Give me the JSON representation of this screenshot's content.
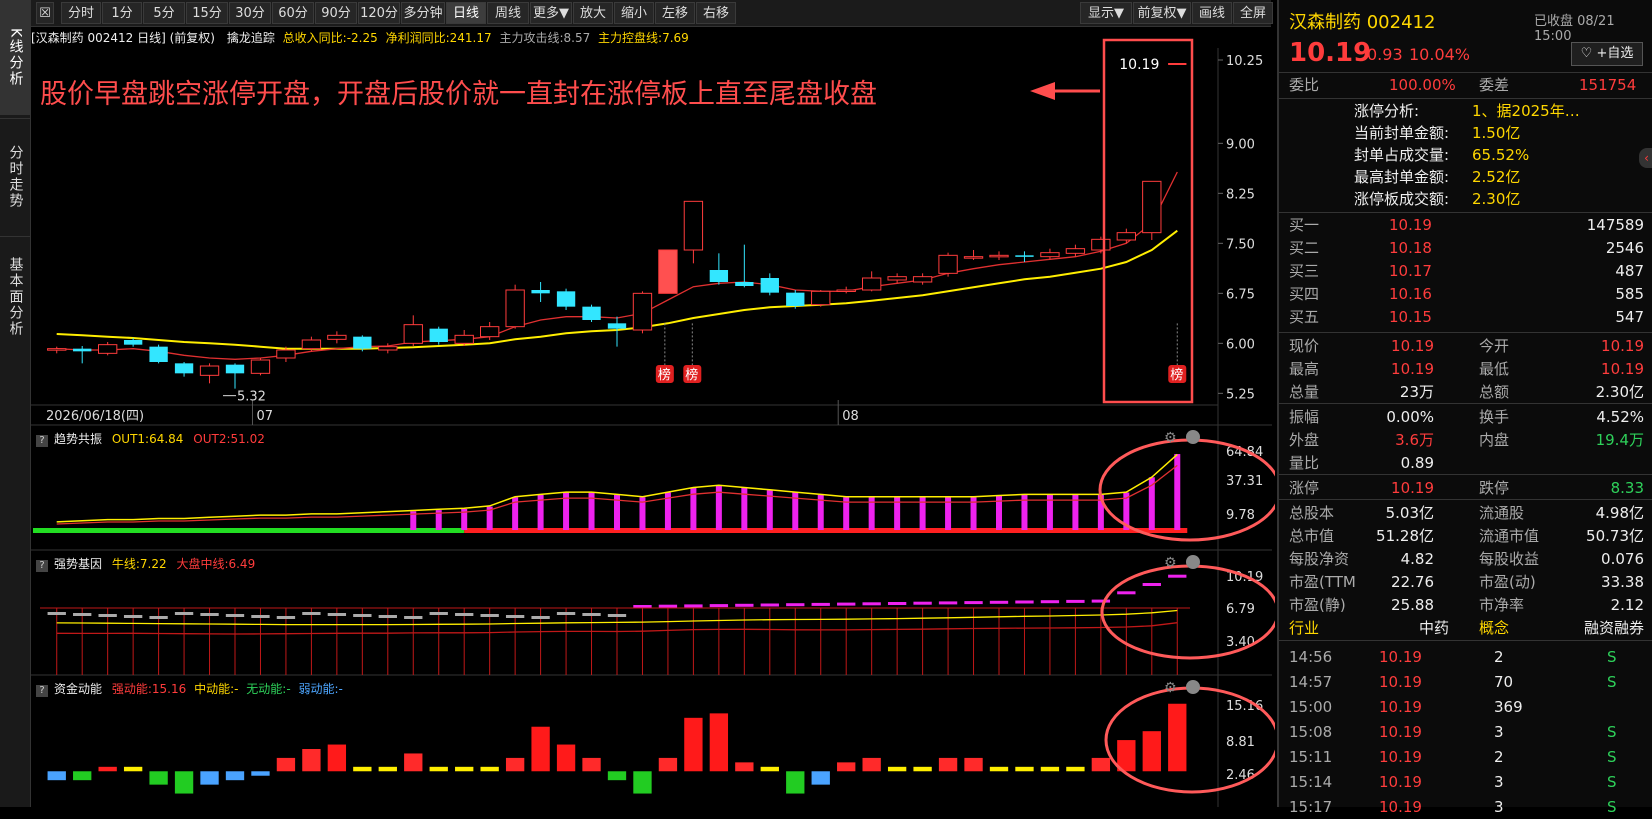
{
  "toolbar": {
    "buttons": [
      "分时",
      "1分",
      "5分",
      "15分",
      "30分",
      "60分",
      "90分",
      "120分",
      "多分钟",
      "日线",
      "周线",
      "更多▼",
      "放大",
      "缩小",
      "左移",
      "右移"
    ],
    "right_buttons": [
      "显示▼",
      "前复权▼",
      "画线",
      "全屏"
    ],
    "active": "日线"
  },
  "left_nav": [
    "K线分析",
    "分时走势",
    "基本面分析"
  ],
  "info_bar": {
    "title": "[汉森制药 002412 日线] (前复权)",
    "indicator": "擒龙追踪",
    "revenue_yoy": "总收入同比:-2.25",
    "profit_yoy": "净利润同比:241.17",
    "attack_line": "主力攻击线:8.57",
    "control_line": "主力控盘线:7.69"
  },
  "annotation": "股价早盘跳空涨停开盘，开盘后股价就一直封在涨停板上直至尾盘收盘",
  "main_chart": {
    "y_ticks": [
      "10.25",
      "9.00",
      "8.25",
      "7.50",
      "6.75",
      "6.00",
      "5.25"
    ],
    "date_label": "2026/06/18(四)",
    "month_labels": [
      "07",
      "08"
    ],
    "low_label": "5.32",
    "last_price_label": "10.19",
    "bang": "榜"
  },
  "indicator1": {
    "name": "趋势共振",
    "out1": "OUT1:64.84",
    "out2": "OUT2:51.02",
    "y_ticks": [
      "64.84",
      "37.31",
      "9.78"
    ]
  },
  "indicator2": {
    "name": "强势基因",
    "bull": "牛线:7.22",
    "market": "大盘中线:6.49",
    "y_ticks": [
      "10.19",
      "6.79",
      "3.40"
    ]
  },
  "indicator3": {
    "name": "资金动能",
    "strong": "强动能:15.16",
    "mid": "中动能:-",
    "none": "无动能:-",
    "weak": "弱动能:-",
    "y_ticks": [
      "15.16",
      "8.81",
      "2.46"
    ]
  },
  "chart_data": {
    "type": "candlestick",
    "dates": [
      "06/18"
    ],
    "candles": [
      [
        5.9,
        5.92,
        5.95,
        5.85
      ],
      [
        5.92,
        5.88,
        5.96,
        5.7
      ],
      [
        5.85,
        5.98,
        6.02,
        5.82
      ],
      [
        6.05,
        5.98,
        6.08,
        5.95
      ],
      [
        5.95,
        5.72,
        5.98,
        5.7
      ],
      [
        5.7,
        5.55,
        5.72,
        5.5
      ],
      [
        5.52,
        5.66,
        5.7,
        5.4
      ],
      [
        5.68,
        5.55,
        5.7,
        5.32
      ],
      [
        5.55,
        5.75,
        5.78,
        5.52
      ],
      [
        5.78,
        5.9,
        5.95,
        5.72
      ],
      [
        5.92,
        6.05,
        6.1,
        5.88
      ],
      [
        6.06,
        6.12,
        6.18,
        6.0
      ],
      [
        6.1,
        5.92,
        6.12,
        5.88
      ],
      [
        5.9,
        5.95,
        6.0,
        5.85
      ],
      [
        6.0,
        6.28,
        6.42,
        5.96
      ],
      [
        6.22,
        6.02,
        6.25,
        5.98
      ],
      [
        6.0,
        6.12,
        6.2,
        5.96
      ],
      [
        6.1,
        6.25,
        6.32,
        6.05
      ],
      [
        6.25,
        6.8,
        6.88,
        6.22
      ],
      [
        6.8,
        6.75,
        6.92,
        6.62
      ],
      [
        6.78,
        6.55,
        6.82,
        6.5
      ],
      [
        6.55,
        6.35,
        6.58,
        6.32
      ],
      [
        6.3,
        6.22,
        6.4,
        5.95
      ],
      [
        6.2,
        6.75,
        6.78,
        6.15
      ],
      [
        6.75,
        7.4,
        7.4,
        6.75
      ],
      [
        7.4,
        8.13,
        8.13,
        7.2
      ],
      [
        7.1,
        6.92,
        7.35,
        6.88
      ],
      [
        6.92,
        6.86,
        7.48,
        6.84
      ],
      [
        6.98,
        6.76,
        7.05,
        6.72
      ],
      [
        6.76,
        6.56,
        6.8,
        6.52
      ],
      [
        6.58,
        6.78,
        6.8,
        6.55
      ],
      [
        6.78,
        6.8,
        6.85,
        6.75
      ],
      [
        6.8,
        6.98,
        7.08,
        6.78
      ],
      [
        6.95,
        7.0,
        7.05,
        6.9
      ],
      [
        6.92,
        7.0,
        7.05,
        6.88
      ],
      [
        7.05,
        7.32,
        7.36,
        7.0
      ],
      [
        7.28,
        7.3,
        7.4,
        7.25
      ],
      [
        7.3,
        7.32,
        7.38,
        7.25
      ],
      [
        7.32,
        7.3,
        7.38,
        7.22
      ],
      [
        7.3,
        7.36,
        7.42,
        7.26
      ],
      [
        7.35,
        7.42,
        7.48,
        7.3
      ],
      [
        7.4,
        7.56,
        7.6,
        7.35
      ],
      [
        7.55,
        7.66,
        7.72,
        7.5
      ],
      [
        7.66,
        8.43,
        8.43,
        7.55
      ],
      [
        10.19,
        10.19,
        10.19,
        10.19
      ]
    ],
    "ma_red": [
      5.92,
      5.9,
      5.9,
      5.92,
      5.88,
      5.82,
      5.78,
      5.76,
      5.78,
      5.82,
      5.88,
      5.92,
      5.95,
      5.96,
      6.02,
      6.04,
      6.06,
      6.1,
      6.25,
      6.35,
      6.4,
      6.4,
      6.38,
      6.45,
      6.65,
      6.85,
      6.9,
      6.92,
      6.88,
      6.8,
      6.78,
      6.78,
      6.85,
      6.9,
      6.95,
      7.05,
      7.12,
      7.18,
      7.22,
      7.26,
      7.3,
      7.38,
      7.5,
      7.8,
      8.57
    ],
    "ma_yellow": [
      6.14,
      6.12,
      6.1,
      6.08,
      6.05,
      6.02,
      6.0,
      5.98,
      5.95,
      5.92,
      5.92,
      5.92,
      5.92,
      5.93,
      5.94,
      5.96,
      5.98,
      6.0,
      6.06,
      6.1,
      6.15,
      6.18,
      6.2,
      6.24,
      6.3,
      6.38,
      6.44,
      6.5,
      6.54,
      6.56,
      6.58,
      6.6,
      6.64,
      6.68,
      6.72,
      6.78,
      6.84,
      6.9,
      6.96,
      7.0,
      7.06,
      7.12,
      7.22,
      7.4,
      7.69
    ],
    "ylim": [
      5.15,
      10.4
    ],
    "ind1_bars": [
      6,
      7,
      8,
      8,
      9,
      9,
      10,
      11,
      12,
      12,
      13,
      13,
      14,
      15,
      16,
      17,
      18,
      20,
      28,
      30,
      32,
      32,
      30,
      28,
      32,
      36,
      38,
      36,
      34,
      32,
      30,
      28,
      28,
      28,
      28,
      28,
      28,
      29,
      30,
      30,
      30,
      30,
      32,
      45,
      64.84
    ],
    "ind1_ylim": [
      0,
      70
    ],
    "ind3_values": [
      -2,
      -2,
      1,
      1,
      -3,
      -5,
      -3,
      -2,
      -1,
      3,
      5,
      6,
      1,
      1,
      4,
      1,
      1,
      1,
      3,
      10,
      6,
      3,
      -2,
      -5,
      3,
      12,
      13,
      2,
      1,
      -5,
      -3,
      2,
      3,
      1,
      1,
      3,
      3,
      1,
      1,
      1,
      1,
      3,
      7,
      9,
      15.16
    ],
    "ind3_ylim": [
      -6,
      16
    ]
  },
  "right_panel": {
    "name": "汉森制药 002412",
    "status": "已收盘 08/21 15:00",
    "price": "10.19",
    "change": "0.93",
    "pct": "10.04%",
    "fav": "♡ +自选",
    "webi_label": "委比",
    "webi": "100.00%",
    "weicha_label": "委差",
    "weicha": "151754",
    "limit_analysis": [
      [
        "涨停分析:",
        "1、据2025年…"
      ],
      [
        "当前封单金额:",
        "1.50亿"
      ],
      [
        "封单占成交量:",
        "65.52%"
      ],
      [
        "最高封单金额:",
        "2.52亿"
      ],
      [
        "涨停板成交额:",
        "2.30亿"
      ]
    ],
    "bids": [
      [
        "买一",
        "10.19",
        "147589"
      ],
      [
        "买二",
        "10.18",
        "2546"
      ],
      [
        "买三",
        "10.17",
        "487"
      ],
      [
        "买四",
        "10.16",
        "585"
      ],
      [
        "买五",
        "10.15",
        "547"
      ]
    ],
    "quote_rows": [
      [
        "现价",
        "10.19",
        "今开",
        "10.19"
      ],
      [
        "最高",
        "10.19",
        "最低",
        "10.19"
      ],
      [
        "总量",
        "23万",
        "总额",
        "2.30亿"
      ],
      [
        "振幅",
        "0.00%",
        "换手",
        "4.52%"
      ],
      [
        "外盘",
        "3.6万",
        "内盘",
        "19.4万"
      ],
      [
        "量比",
        "0.89",
        "",
        ""
      ],
      [
        "涨停",
        "10.19",
        "跌停",
        "8.33"
      ],
      [
        "总股本",
        "5.03亿",
        "流通股",
        "4.98亿"
      ],
      [
        "总市值",
        "51.28亿",
        "流通市值",
        "50.73亿"
      ],
      [
        "每股净资",
        "4.82",
        "每股收益",
        "0.076"
      ],
      [
        "市盈(TTM",
        "22.76",
        "市盈(动)",
        "33.38"
      ],
      [
        "市盈(静)",
        "25.88",
        "市净率",
        "2.12"
      ]
    ],
    "industry_row": [
      "行业",
      "中药",
      "概念",
      "融资融券"
    ],
    "ticks": [
      [
        "14:56",
        "10.19",
        "2",
        "S"
      ],
      [
        "14:57",
        "10.19",
        "70",
        "S"
      ],
      [
        "15:00",
        "10.19",
        "369",
        ""
      ],
      [
        "15:08",
        "10.19",
        "3",
        "S"
      ],
      [
        "15:11",
        "10.19",
        "2",
        "S"
      ],
      [
        "15:14",
        "10.19",
        "3",
        "S"
      ],
      [
        "15:17",
        "10.19",
        "3",
        "S"
      ]
    ],
    "colors": {
      "up": "#ff3c3c",
      "down": "#2ed15a",
      "label": "#ffd700",
      "accent": "#ff3c3c"
    }
  }
}
